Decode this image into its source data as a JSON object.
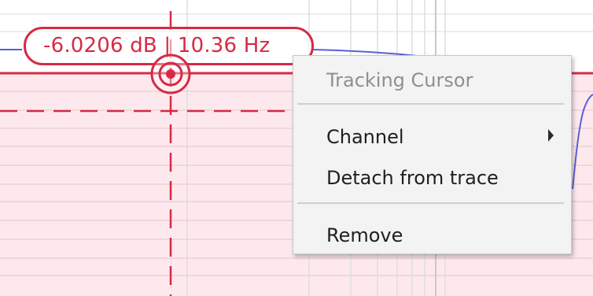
{
  "cursor": {
    "readout": "-6.0206 dB | 10.36 Hz",
    "color": "#d62a45"
  },
  "context_menu": {
    "header": "Tracking Cursor",
    "channel_label": "Channel",
    "detach_label": "Detach from trace",
    "remove_label": "Remove"
  },
  "icons": {
    "cursor_handle": "target-icon",
    "submenu": "chevron-right-icon"
  },
  "colors": {
    "cursor": "#d62a45",
    "region_fill": "#fde9ed",
    "trace": "#5a5fd6",
    "menu_bg": "#f3f3f3"
  }
}
